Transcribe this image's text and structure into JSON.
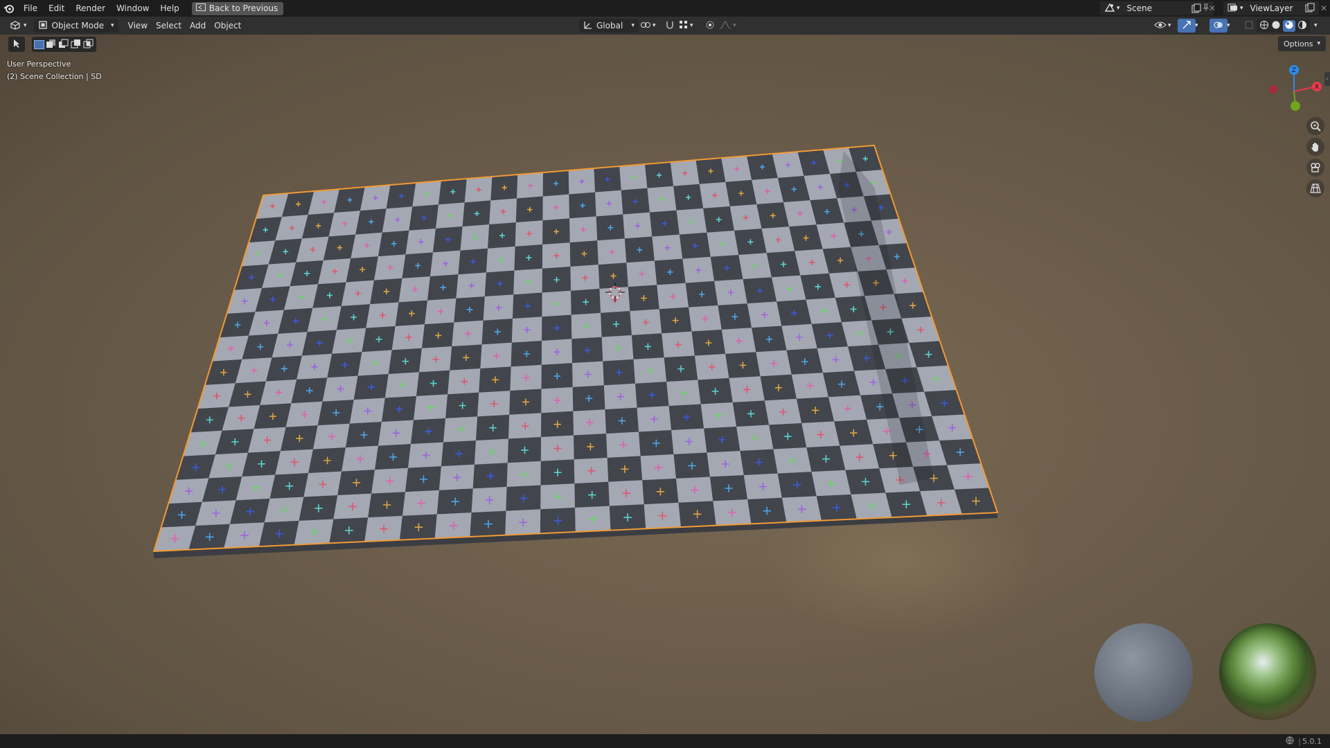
{
  "topbar": {
    "menus": [
      "File",
      "Edit",
      "Render",
      "Window",
      "Help"
    ],
    "back_label": "Back to Previous",
    "scene_name": "Scene",
    "view_layer": "ViewLayer"
  },
  "viewport_header": {
    "mode": "Object Mode",
    "menus": [
      "View",
      "Select",
      "Add",
      "Object"
    ],
    "orientation": "Global"
  },
  "viewport": {
    "perspective": "User Perspective",
    "collection": "(2) Scene Collection | SD",
    "options_label": "Options",
    "gizmo": {
      "x": "X",
      "y": "Y",
      "z": "Z"
    }
  },
  "statusbar": {
    "version": "5.0.1"
  },
  "colors": {
    "accent": "#4772b3",
    "selection_outline": "#f39a35",
    "axis_x": "#e63b4e",
    "axis_y": "#6fa51f",
    "axis_z": "#2d8ceb"
  }
}
